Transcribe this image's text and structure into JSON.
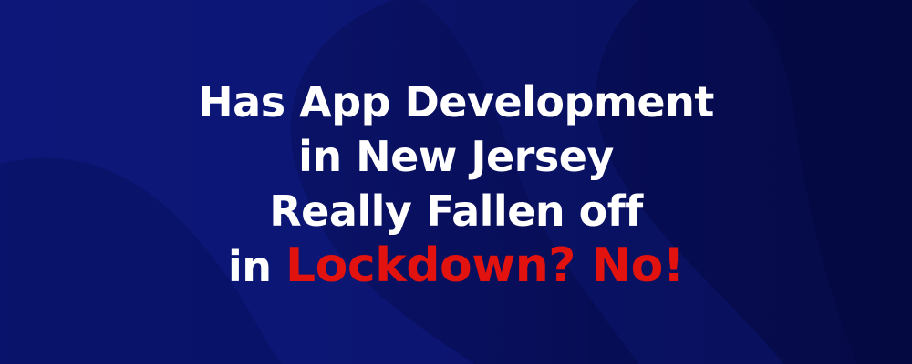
{
  "headline": {
    "line1": "Has App Development",
    "line2": "in New Jersey",
    "line3": "Really Fallen off",
    "line4_prefix": "in",
    "line4_accent": "Lockdown? No!"
  },
  "colors": {
    "background": "#0a1266",
    "text": "#ffffff",
    "accent": "#e2130f"
  }
}
